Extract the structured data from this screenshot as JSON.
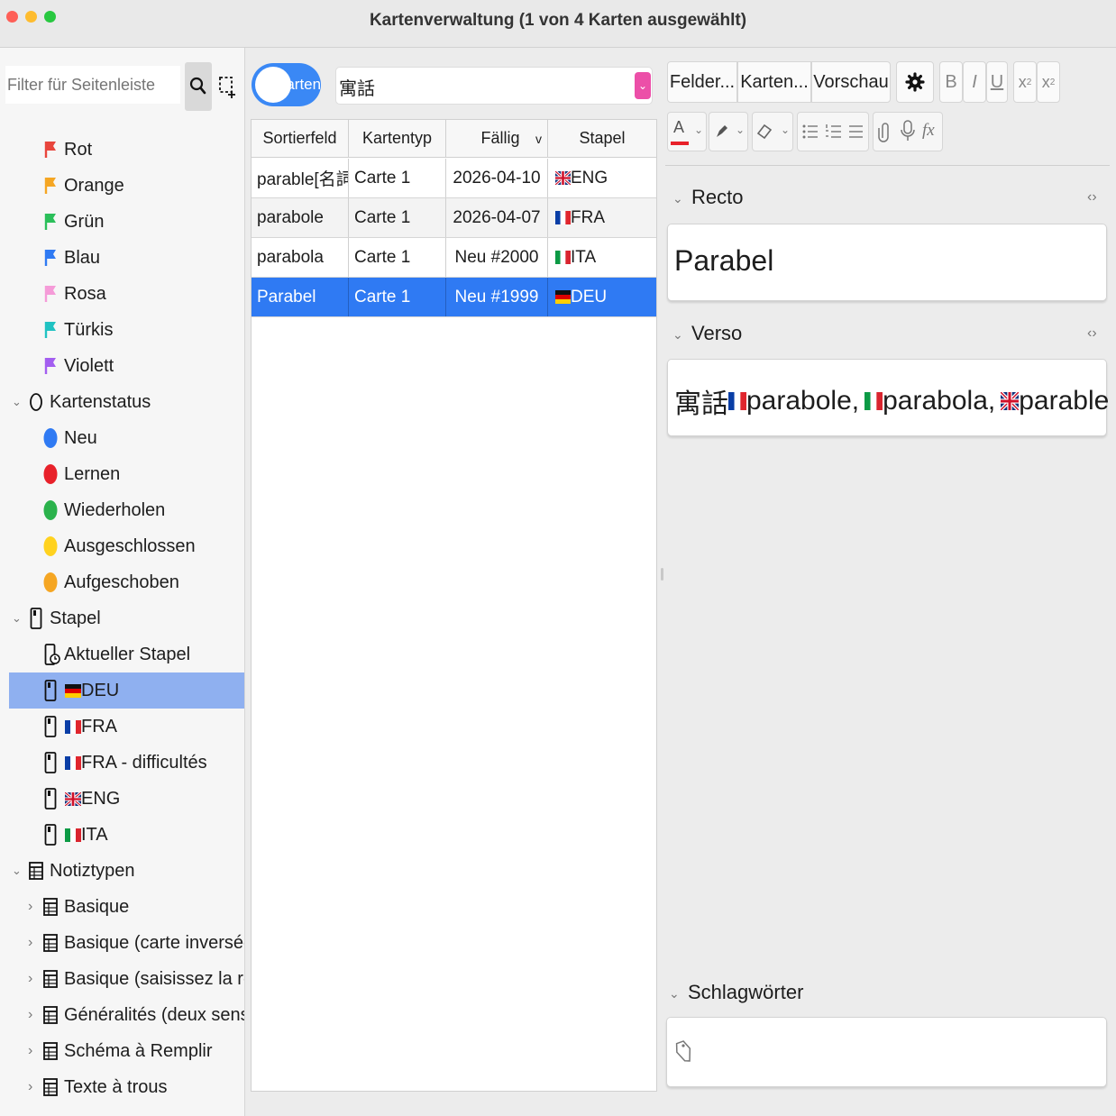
{
  "window": {
    "title": "Kartenverwaltung (1 von 4 Karten ausgewählt)"
  },
  "colors": {
    "accent": "#2f7af3",
    "sidebar_selected": "#8fb0f0",
    "toggle": "#3a88f5",
    "dropdown": "#ec4fa8"
  },
  "sidebar": {
    "filter_placeholder": "Filter für Seitenleiste",
    "flags": [
      {
        "label": "Rot",
        "color": "#e8453c"
      },
      {
        "label": "Orange",
        "color": "#f5a623"
      },
      {
        "label": "Grün",
        "color": "#2bbf5a"
      },
      {
        "label": "Blau",
        "color": "#2f7af3"
      },
      {
        "label": "Rosa",
        "color": "#f59bd8"
      },
      {
        "label": "Türkis",
        "color": "#20c2c2"
      },
      {
        "label": "Violett",
        "color": "#a35ef0"
      }
    ],
    "card_status": {
      "label": "Kartenstatus",
      "items": [
        {
          "label": "Neu",
          "color": "#2f7af3"
        },
        {
          "label": "Lernen",
          "color": "#e8212a"
        },
        {
          "label": "Wiederholen",
          "color": "#2bb24c"
        },
        {
          "label": "Ausgeschlossen",
          "color": "#ffd21f"
        },
        {
          "label": "Aufgeschoben",
          "color": "#f5a623"
        }
      ]
    },
    "decks": {
      "label": "Stapel",
      "current": "Aktueller Stapel",
      "items": [
        {
          "label": "DEU",
          "flag": "de",
          "selected": true
        },
        {
          "label": "FRA",
          "flag": "fr",
          "selected": false
        },
        {
          "label": "FRA - difficultés",
          "flag": "fr",
          "selected": false
        },
        {
          "label": "ENG",
          "flag": "gb",
          "selected": false
        },
        {
          "label": "ITA",
          "flag": "it",
          "selected": false
        }
      ]
    },
    "note_types": {
      "label": "Notiztypen",
      "items": [
        "Basique",
        "Basique (carte inversée opti...",
        "Basique (saisissez la réponse)",
        "Généralités (deux sens)",
        "Schéma à Remplir",
        "Texte à trous"
      ]
    }
  },
  "browser": {
    "toggle_label": "Karten",
    "search_value": "寓話",
    "columns": [
      "Sortierfeld",
      "Kartentyp",
      "Fällig",
      "Stapel"
    ],
    "sort_indicator": "v",
    "rows": [
      {
        "sort": "parable[名詞]",
        "type": "Carte 1",
        "due": "2026-04-10",
        "deck": "ENG",
        "flag": "gb",
        "selected": false
      },
      {
        "sort": "parabole",
        "type": "Carte 1",
        "due": "2026-04-07",
        "deck": "FRA",
        "flag": "fr",
        "selected": false
      },
      {
        "sort": "parabola",
        "type": "Carte 1",
        "due": "Neu #2000",
        "deck": "ITA",
        "flag": "it",
        "selected": false
      },
      {
        "sort": "Parabel",
        "type": "Carte 1",
        "due": "Neu #1999",
        "deck": "DEU",
        "flag": "de",
        "selected": true
      }
    ]
  },
  "editor": {
    "buttons": {
      "fields": "Felder...",
      "cards": "Karten...",
      "preview": "Vorschau"
    },
    "format": {
      "bold": "B",
      "italic": "I",
      "underline": "U",
      "text_color": "A",
      "math": "fx",
      "superscript": "x",
      "subscript": "x",
      "script_mark": "2"
    },
    "front": {
      "label": "Recto",
      "value": "Parabel"
    },
    "back": {
      "label": "Verso",
      "prefix": "寓話",
      "parts": [
        {
          "flag": "fr",
          "text": "parabole,"
        },
        {
          "flag": "it",
          "text": "parabola,"
        },
        {
          "flag": "gb",
          "text": "parable"
        }
      ]
    },
    "tags": {
      "label": "Schlagwörter"
    }
  }
}
